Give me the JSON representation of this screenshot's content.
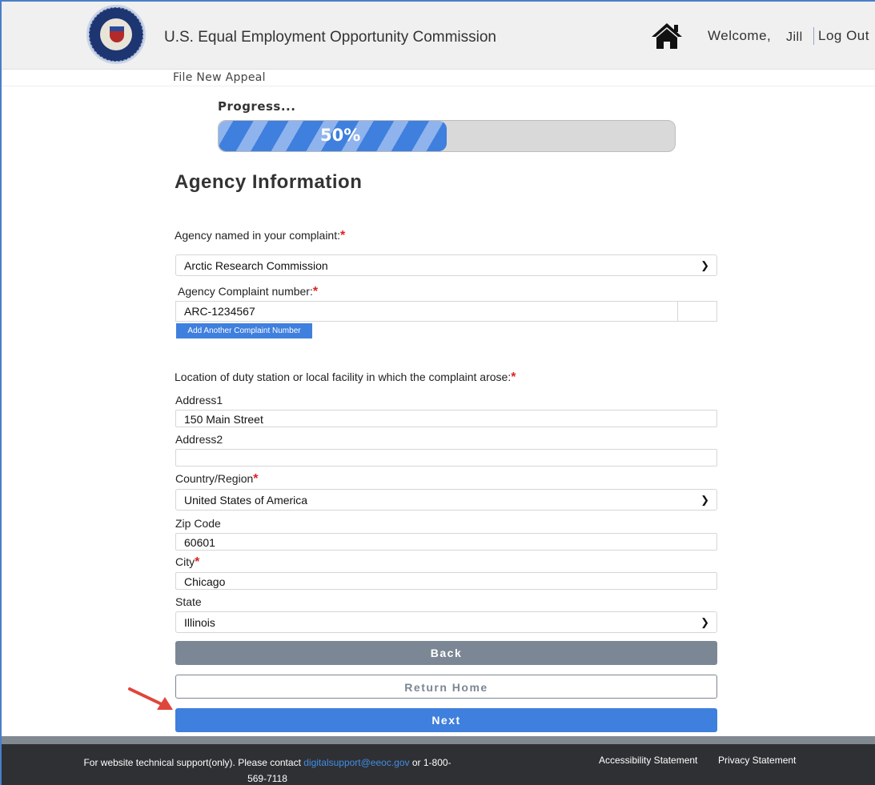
{
  "header": {
    "org_title": "U.S. Equal Employment Opportunity Commission",
    "welcome": "Welcome,",
    "user_name": "Jill",
    "logout": "Log Out"
  },
  "breadcrumb": "File New Appeal",
  "progress": {
    "label": "Progress...",
    "percent_text": "50%",
    "value": 0.5
  },
  "section_title": "Agency Information",
  "agency": {
    "label": "Agency named in your complaint:",
    "selected": "Arctic Research Commission"
  },
  "complaint": {
    "label": "Agency Complaint number:",
    "value": "ARC-1234567",
    "add_button": "Add Another Complaint Number"
  },
  "location": {
    "label": "Location of duty station or local facility in which the complaint arose:",
    "address1_label": "Address1",
    "address1_value": "150 Main Street",
    "address2_label": "Address2",
    "address2_value": "",
    "country_label": "Country/Region",
    "country_selected": "United States of America",
    "zip_label": "Zip Code",
    "zip_value": "60601",
    "city_label": "City",
    "city_value": "Chicago",
    "state_label": "State",
    "state_selected": "Illinois"
  },
  "required_marker": "*",
  "buttons": {
    "back": "Back",
    "return_home": "Return Home",
    "next": "Next"
  },
  "footer": {
    "support_prefix": "For website technical support(only). Please contact",
    "support_email": "digitalsupport@eeoc.gov",
    "support_suffix": "or 1-800-569-7118",
    "accessibility": "Accessibility Statement",
    "privacy": "Privacy Statement"
  },
  "colors": {
    "accent": "#3f7fde",
    "required": "#e02020",
    "back_button": "#7b8794",
    "footer_bg": "#2f3033",
    "annotation_arrow": "#e0453a"
  },
  "icons": [
    "seal-logo",
    "home-icon",
    "chevron-down-icon",
    "annotation-arrow"
  ]
}
